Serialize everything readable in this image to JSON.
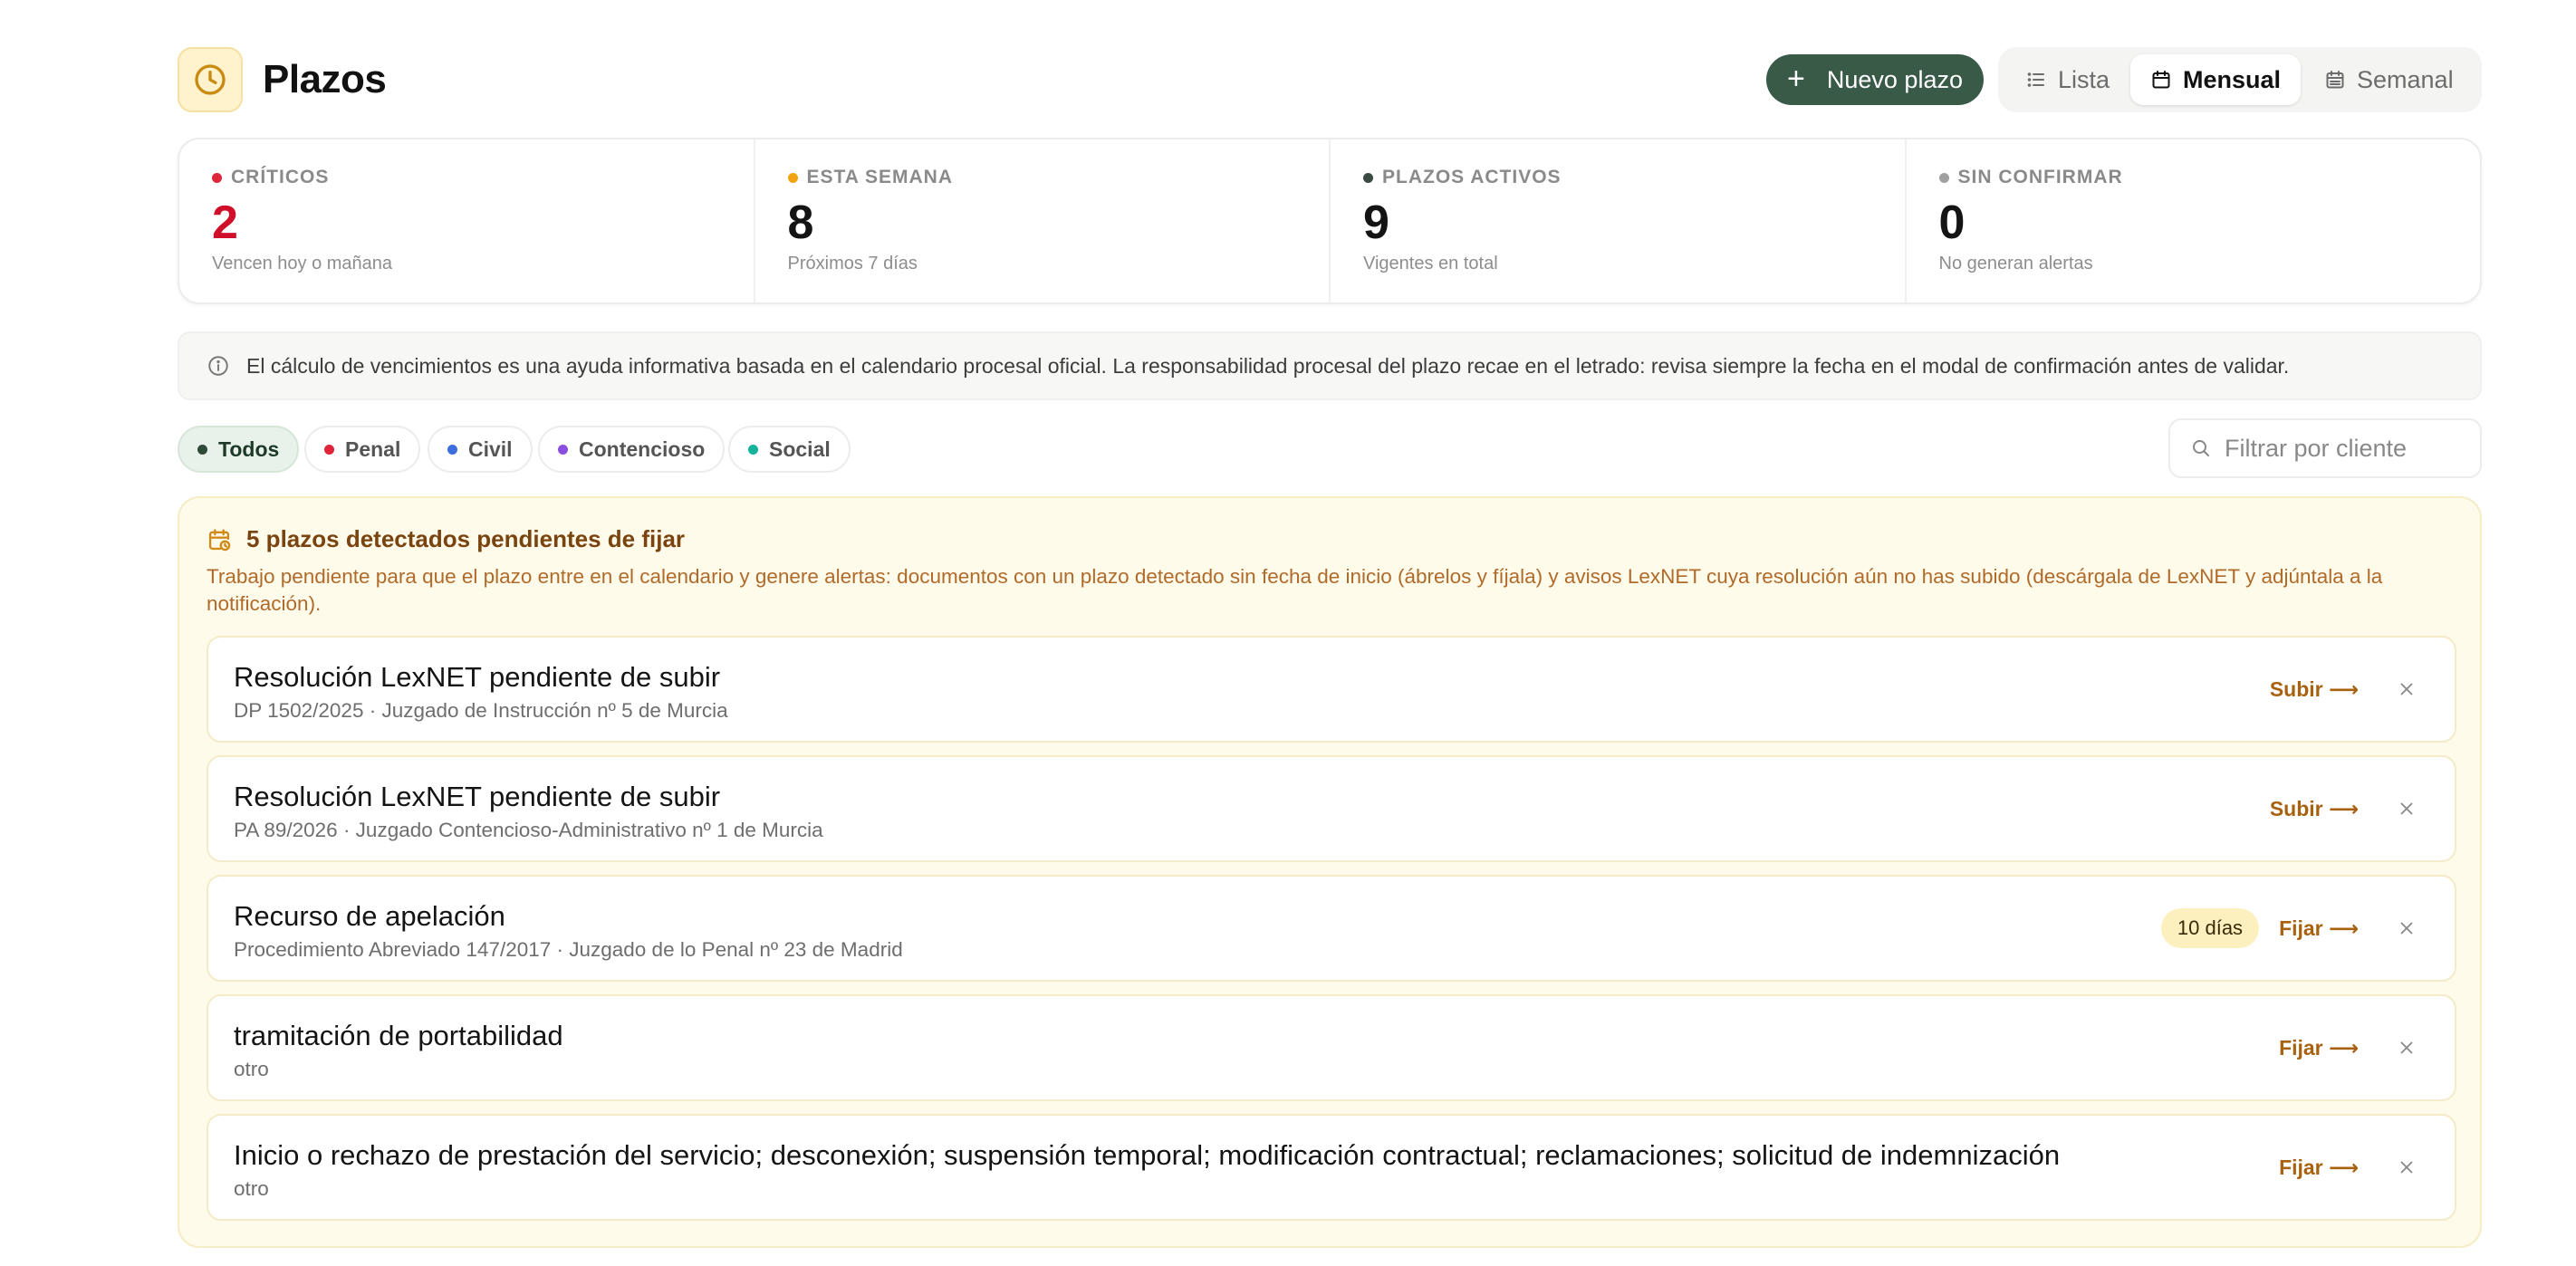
{
  "header": {
    "title": "Plazos",
    "new_button": "Nuevo plazo",
    "views": [
      {
        "label": "Lista",
        "active": false
      },
      {
        "label": "Mensual",
        "active": true
      },
      {
        "label": "Semanal",
        "active": false
      }
    ]
  },
  "stats": [
    {
      "label": "CRÍTICOS",
      "value": "2",
      "sub": "Vencen hoy o mañana",
      "dot_color": "#e0243a"
    },
    {
      "label": "ESTA SEMANA",
      "value": "8",
      "sub": "Próximos 7 días",
      "dot_color": "#f0a510"
    },
    {
      "label": "PLAZOS ACTIVOS",
      "value": "9",
      "sub": "Vigentes en total",
      "dot_color": "#3a4a40"
    },
    {
      "label": "SIN CONFIRMAR",
      "value": "0",
      "sub": "No generan alertas",
      "dot_color": "#a0a0a0"
    }
  ],
  "info_banner": "El cálculo de vencimientos es una ayuda informativa basada en el calendario procesal oficial. La responsabilidad procesal del plazo recae en el letrado: revisa siempre la fecha en el modal de confirmación antes de validar.",
  "filters": [
    {
      "label": "Todos",
      "dot_color": "#2e4a38",
      "active": true
    },
    {
      "label": "Penal",
      "dot_color": "#e0243a",
      "active": false
    },
    {
      "label": "Civil",
      "dot_color": "#3b6fe0",
      "active": false
    },
    {
      "label": "Contencioso",
      "dot_color": "#8a4fe0",
      "active": false
    },
    {
      "label": "Social",
      "dot_color": "#14b39a",
      "active": false
    }
  ],
  "search": {
    "placeholder": "Filtrar por cliente"
  },
  "pending": {
    "title": "5 plazos detectados pendientes de fijar",
    "description": "Trabajo pendiente para que el plazo entre en el calendario y genere alertas: documentos con un plazo detectado sin fecha de inicio (ábrelos y fíjala) y avisos LexNET cuya resolución aún no has subido (descárgala de LexNET y adjúntala a la notificación).",
    "items": [
      {
        "title": "Resolución LexNET pendiente de subir",
        "sub": "DP 1502/2025 · Juzgado de Instrucción nº 5 de Murcia",
        "action": "Subir ⟶",
        "days": ""
      },
      {
        "title": "Resolución LexNET pendiente de subir",
        "sub": "PA 89/2026 · Juzgado Contencioso-Administrativo nº 1 de Murcia",
        "action": "Subir ⟶",
        "days": ""
      },
      {
        "title": "Recurso de apelación",
        "sub": "Procedimiento Abreviado 147/2017 · Juzgado de lo Penal nº 23 de Madrid",
        "action": "Fijar ⟶",
        "days": "10 días"
      },
      {
        "title": "tramitación de portabilidad",
        "sub": "otro",
        "action": "Fijar ⟶",
        "days": ""
      },
      {
        "title": "Inicio o rechazo de prestación del servicio; desconexión; suspensión temporal; modificación contractual; reclamaciones; solicitud de indemnización",
        "sub": "otro",
        "action": "Fijar ⟶",
        "days": ""
      }
    ]
  }
}
